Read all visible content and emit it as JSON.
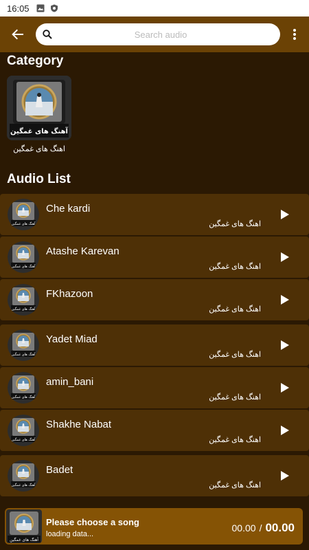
{
  "status_bar": {
    "time": "16:05"
  },
  "search": {
    "placeholder": "Search audio"
  },
  "category_section": {
    "title": "Category",
    "items": [
      {
        "label": "اهنگ های غمگین",
        "thumb_caption": "آهنگ های غمگین"
      }
    ]
  },
  "audio_section": {
    "title": "Audio List",
    "items": [
      {
        "title": "Che kardi",
        "subtitle": "اهنگ های غمگین",
        "thumb_caption": "آهنگ های غمگین"
      },
      {
        "title": "Atashe Karevan",
        "subtitle": "اهنگ های غمگین",
        "thumb_caption": "آهنگ های غمگین"
      },
      {
        "title": "FKhazoon",
        "subtitle": "اهنگ های غمگین",
        "thumb_caption": "آهنگ های غمگین"
      },
      {
        "title": "Yadet Miad",
        "subtitle": "اهنگ های غمگین",
        "thumb_caption": "آهنگ های غمگین"
      },
      {
        "title": "amin_bani",
        "subtitle": "اهنگ های غمگین",
        "thumb_caption": "آهنگ های غمگین"
      },
      {
        "title": "Shakhe Nabat",
        "subtitle": "اهنگ های غمگین",
        "thumb_caption": "آهنگ های غمگین"
      },
      {
        "title": "Badet",
        "subtitle": "اهنگ های غمگین",
        "thumb_caption": "آهنگ های غمگین"
      }
    ]
  },
  "player": {
    "title": "Please choose a song",
    "status": "loading data...",
    "current_time": "00.00",
    "separator": "/",
    "duration": "00.00",
    "thumb_caption": "آهنگ های غمگین"
  },
  "icons": {
    "back": "arrow-left-icon",
    "search": "search-icon",
    "menu": "more-vert-icon",
    "play": "play-icon"
  },
  "colors": {
    "app_bar": "#6b4205",
    "background": "#2b1903",
    "row": "#4e3006",
    "player": "#855305"
  }
}
